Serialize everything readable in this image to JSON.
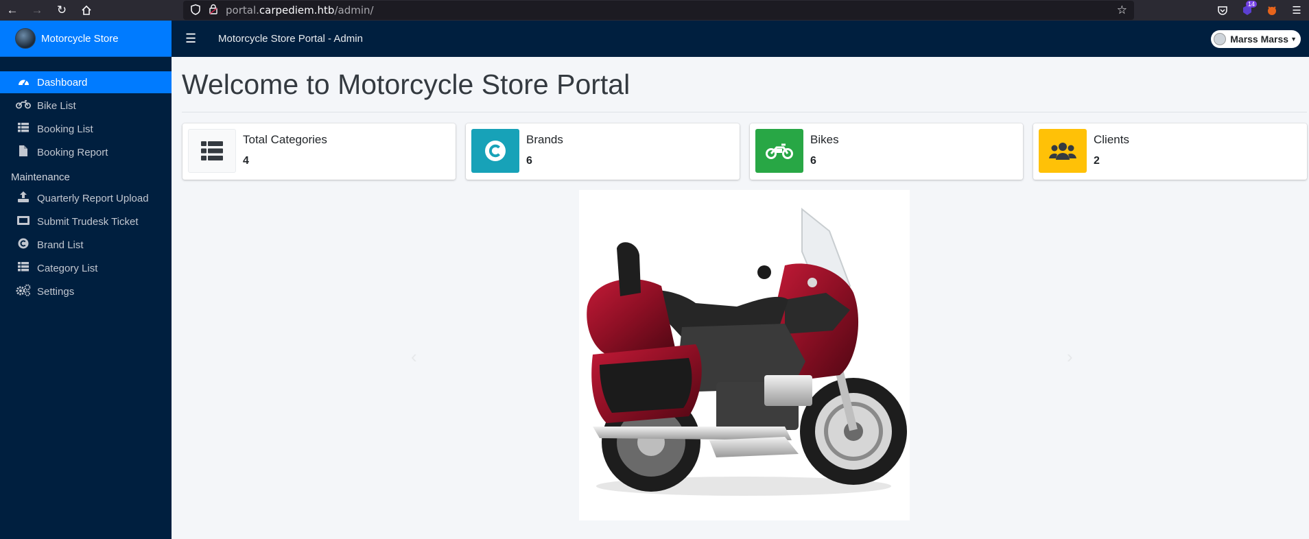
{
  "browser": {
    "url_prefix": "portal.",
    "url_host": "carpediem.htb",
    "url_path": "/admin/",
    "ext_badge": "14"
  },
  "sidebar": {
    "brand": "Motorcycle Store",
    "items": [
      {
        "label": "Dashboard",
        "icon": "tachometer-icon",
        "active": true
      },
      {
        "label": "Bike List",
        "icon": "motorcycle-icon"
      },
      {
        "label": "Booking List",
        "icon": "list-icon"
      },
      {
        "label": "Booking Report",
        "icon": "file-icon"
      }
    ],
    "section_header": "Maintenance",
    "maintenance_items": [
      {
        "label": "Quarterly Report Upload",
        "icon": "upload-icon"
      },
      {
        "label": "Submit Trudesk Ticket",
        "icon": "ticket-icon"
      },
      {
        "label": "Brand List",
        "icon": "copyright-icon"
      },
      {
        "label": "Category List",
        "icon": "list-icon"
      },
      {
        "label": "Settings",
        "icon": "cogs-icon"
      }
    ]
  },
  "topnav": {
    "title": "Motorcycle Store Portal - Admin",
    "user_name": "Marss Marss"
  },
  "main": {
    "heading": "Welcome to Motorcycle Store Portal",
    "info_boxes": [
      {
        "label": "Total Categories",
        "value": "4",
        "color": "#f8f9fa",
        "icon": "th-list-icon"
      },
      {
        "label": "Brands",
        "value": "6",
        "color": "#17a2b8",
        "icon": "copyright-icon"
      },
      {
        "label": "Bikes",
        "value": "6",
        "color": "#28a745",
        "icon": "motorcycle-icon"
      },
      {
        "label": "Clients",
        "value": "2",
        "color": "#ffc107",
        "icon": "users-icon"
      }
    ]
  },
  "colors": {
    "sidebar_bg": "#001f3f",
    "active": "#007bff",
    "page_bg": "#f4f6f9"
  }
}
